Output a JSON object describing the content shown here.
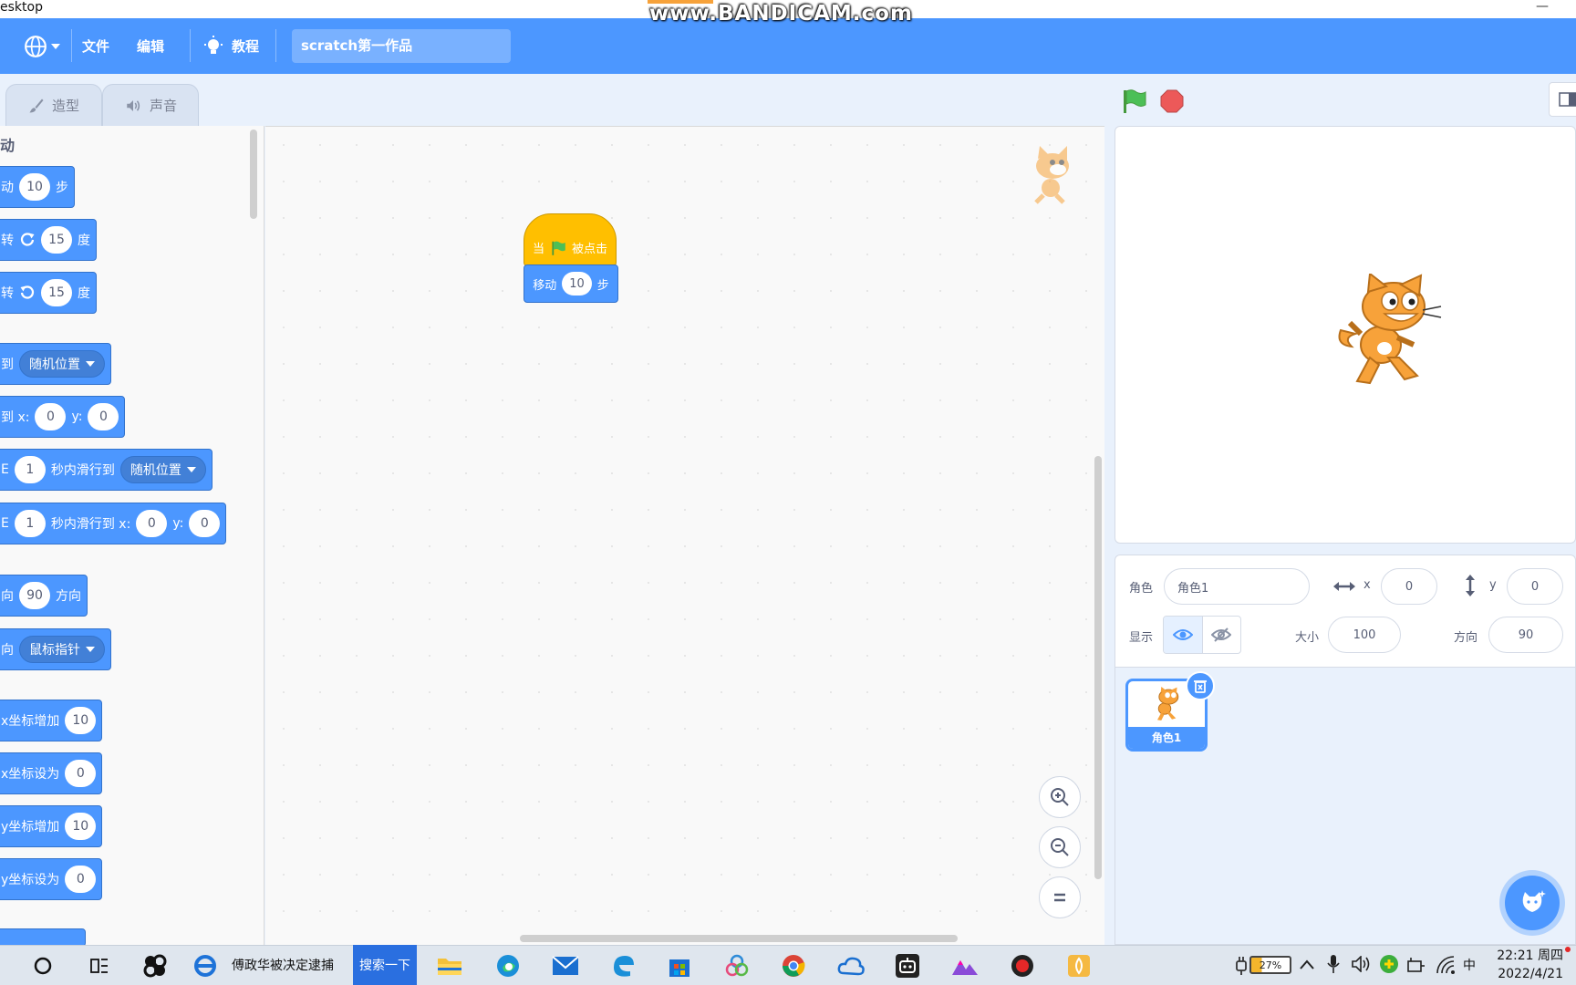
{
  "window": {
    "title": "esktop",
    "minimize": "—"
  },
  "watermark": "www.BANDICAM.com",
  "menu": {
    "file": "文件",
    "edit": "编辑",
    "tutorials": "教程",
    "project_title": "scratch第一作品"
  },
  "tabs": {
    "costumes": "造型",
    "sounds": "声音"
  },
  "palette": {
    "category": "动",
    "blocks": {
      "move": {
        "label": "动",
        "value": "10",
        "suffix": "步"
      },
      "turn_right": {
        "label": "转",
        "value": "15",
        "suffix": "度"
      },
      "turn_left": {
        "label": "转",
        "value": "15",
        "suffix": "度"
      },
      "goto": {
        "label": "到",
        "dropdown": "随机位置"
      },
      "goto_xy": {
        "label": "到 x:",
        "x": "0",
        "ylabel": "y:",
        "y": "0"
      },
      "glide": {
        "label": "E",
        "value": "1",
        "text": "秒内滑行到",
        "dropdown": "随机位置"
      },
      "glide_xy": {
        "label": "E",
        "value": "1",
        "text": "秒内滑行到 x:",
        "x": "0",
        "ylabel": "y:",
        "y": "0"
      },
      "point_dir": {
        "label": "向",
        "value": "90",
        "suffix": "方向"
      },
      "point_towards": {
        "label": "向",
        "dropdown": "鼠标指针"
      },
      "change_x": {
        "label": "x坐标增加",
        "value": "10"
      },
      "set_x": {
        "label": "x坐标设为",
        "value": "0"
      },
      "change_y": {
        "label": "y坐标增加",
        "value": "10"
      },
      "set_y": {
        "label": "y坐标设为",
        "value": "0"
      }
    }
  },
  "script": {
    "hat": {
      "when": "当",
      "clicked": "被点击"
    },
    "move": {
      "label": "移动",
      "value": "10",
      "suffix": "步"
    }
  },
  "sprite_info": {
    "sprite_label": "角色",
    "sprite_name": "角色1",
    "x_label": "x",
    "x": "0",
    "y_label": "y",
    "y": "0",
    "show_label": "显示",
    "size_label": "大小",
    "size": "100",
    "direction_label": "方向",
    "direction": "90"
  },
  "sprite_list": [
    {
      "name": "角色1"
    }
  ],
  "taskbar": {
    "browser_tab": "傅政华被决定逮捕",
    "search": "搜索一下",
    "battery": "27%",
    "ime": "中",
    "time": "22:21 周四",
    "date": "2022/4/21"
  },
  "colors": {
    "scratch_blue": "#4c97ff",
    "event_yellow": "#ffbf00",
    "stop_red": "#ec5959",
    "flag_green": "#4cbf56"
  }
}
